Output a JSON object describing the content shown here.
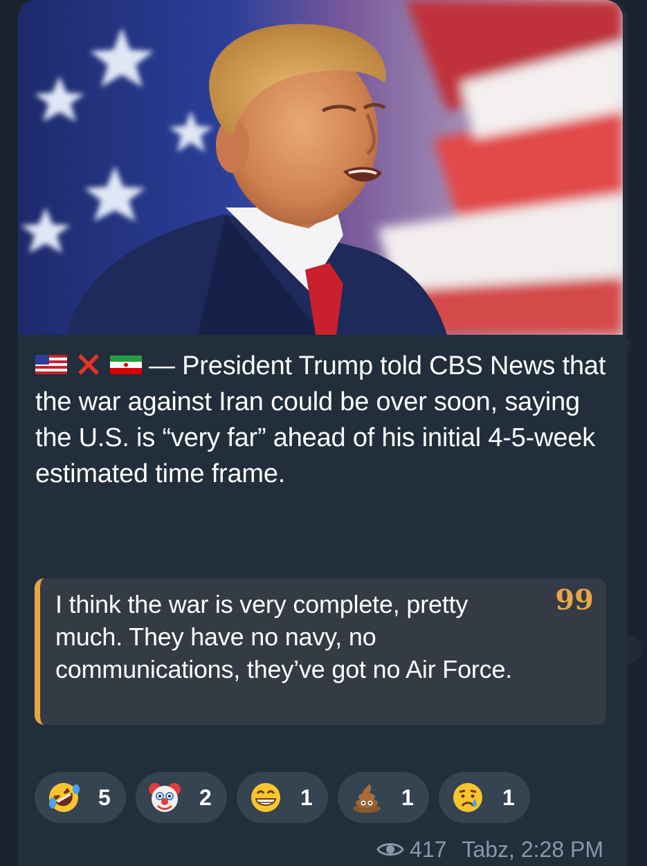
{
  "message": {
    "caption_text": "— President Trump told CBS News that the war against Iran could be over soon, saying the U.S. is “very far” ahead of his initial 4-5-week estimated time frame.",
    "caption_icons": [
      "us-flag-icon",
      "cross-mark-icon",
      "iran-flag-icon"
    ],
    "quote_text": "I think the war is very complete, pretty much. They have no navy, no communications, they’ve got no Air Force.",
    "quote_mark": "99",
    "reactions": [
      {
        "icon": "rolling-on-floor-laughing-emoji",
        "count": "5"
      },
      {
        "icon": "clown-face-emoji",
        "count": "2"
      },
      {
        "icon": "grinning-face-emoji",
        "count": "1"
      },
      {
        "icon": "pile-of-poo-emoji",
        "count": "1"
      },
      {
        "icon": "crying-face-emoji",
        "count": "1"
      }
    ],
    "views": "417",
    "author_time": "Tabz, 2:28 PM"
  },
  "colors": {
    "bubble": "#222e3b",
    "quote_bg": "#343b44",
    "quote_accent": "#e8a547",
    "reaction_bg": "#364351",
    "meta_text": "#8a99a8"
  }
}
